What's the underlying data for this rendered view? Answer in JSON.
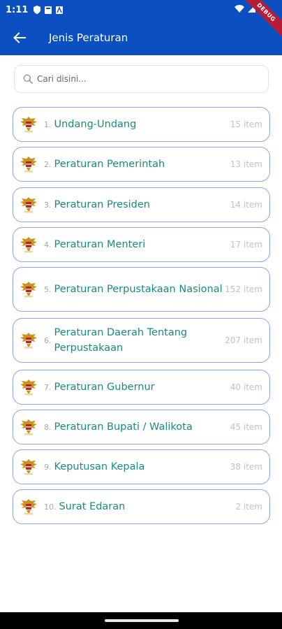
{
  "status": {
    "time": "1:11",
    "debug_label": "DEBUG"
  },
  "appbar": {
    "title": "Jenis Peraturan",
    "back_icon": "arrow-back-icon",
    "color": "#0c4fc0"
  },
  "search": {
    "placeholder": "Cari disini...",
    "value": "",
    "icon": "search-icon"
  },
  "colors": {
    "item_border": "#8aa6e8",
    "item_label": "#1b8a7a",
    "item_count": "#c2c2c2"
  },
  "items": [
    {
      "num": "1.",
      "label": "Undang-Undang",
      "count": "15 item",
      "icon": "garuda-emblem-icon"
    },
    {
      "num": "2.",
      "label": "Peraturan Pemerintah",
      "count": "13 item",
      "icon": "garuda-emblem-icon"
    },
    {
      "num": "3.",
      "label": "Peraturan Presiden",
      "count": "14 item",
      "icon": "garuda-emblem-icon"
    },
    {
      "num": "4.",
      "label": "Peraturan Menteri",
      "count": "17 item",
      "icon": "garuda-emblem-icon"
    },
    {
      "num": "5.",
      "label": "Peraturan Perpustakaan Nasional",
      "count": "152 item",
      "icon": "garuda-emblem-icon"
    },
    {
      "num": "6.",
      "label": "Peraturan Daerah Tentang Perpustakaan",
      "count": "207 item",
      "icon": "garuda-emblem-icon"
    },
    {
      "num": "7.",
      "label": "Peraturan Gubernur",
      "count": "40 item",
      "icon": "garuda-emblem-icon"
    },
    {
      "num": "8.",
      "label": "Peraturan Bupati / Walikota",
      "count": "45 item",
      "icon": "garuda-emblem-icon"
    },
    {
      "num": "9.",
      "label": "Keputusan Kepala",
      "count": "38 item",
      "icon": "garuda-emblem-icon"
    },
    {
      "num": "10.",
      "label": "Surat Edaran",
      "count": "2 item",
      "icon": "garuda-emblem-icon"
    }
  ]
}
